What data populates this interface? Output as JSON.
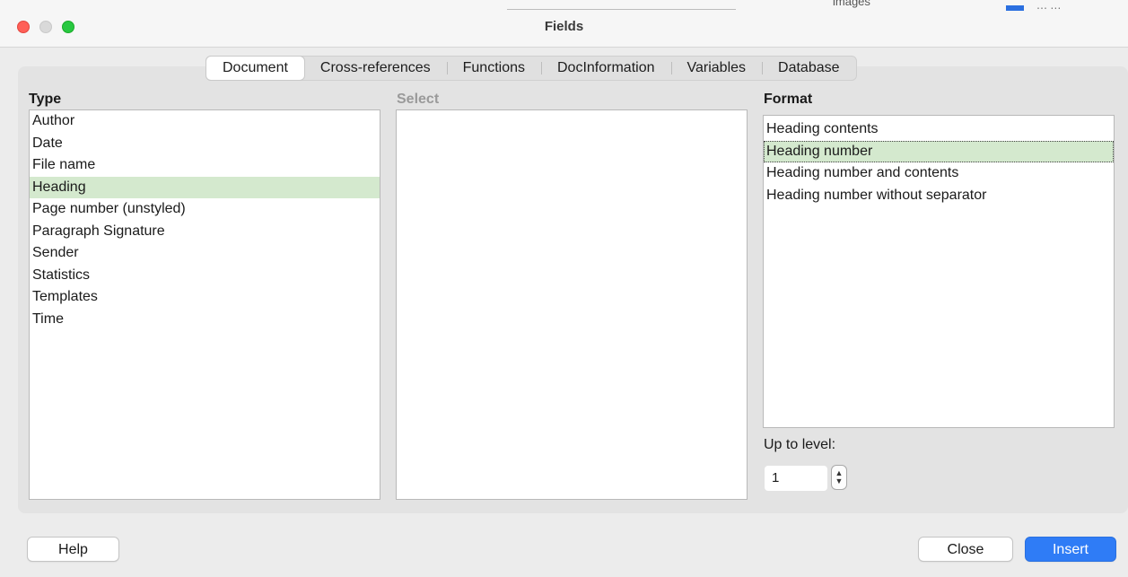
{
  "window": {
    "title": "Fields"
  },
  "background_fragments": {
    "text": "images",
    "gray": "⋯ ⋯"
  },
  "tabs": [
    {
      "label": "Document",
      "active": true
    },
    {
      "label": "Cross-references",
      "active": false
    },
    {
      "label": "Functions",
      "active": false
    },
    {
      "label": "DocInformation",
      "active": false
    },
    {
      "label": "Variables",
      "active": false
    },
    {
      "label": "Database",
      "active": false
    }
  ],
  "type": {
    "label": "Type",
    "items": [
      "Author",
      "Date",
      "File name",
      "Heading",
      "Page number (unstyled)",
      "Paragraph Signature",
      "Sender",
      "Statistics",
      "Templates",
      "Time"
    ],
    "selected": "Heading"
  },
  "select": {
    "label": "Select",
    "items": []
  },
  "format": {
    "label": "Format",
    "items": [
      "Heading contents",
      "Heading number",
      "Heading number and contents",
      "Heading number without separator"
    ],
    "selected": "Heading number"
  },
  "up_to_level": {
    "label": "Up to level:",
    "value": "1"
  },
  "buttons": {
    "help": "Help",
    "close": "Close",
    "insert": "Insert"
  },
  "colors": {
    "selection": "#d4e9ce",
    "primary_button": "#2f7cf6",
    "close_light": "#ff5f57",
    "max_light": "#28c840"
  }
}
